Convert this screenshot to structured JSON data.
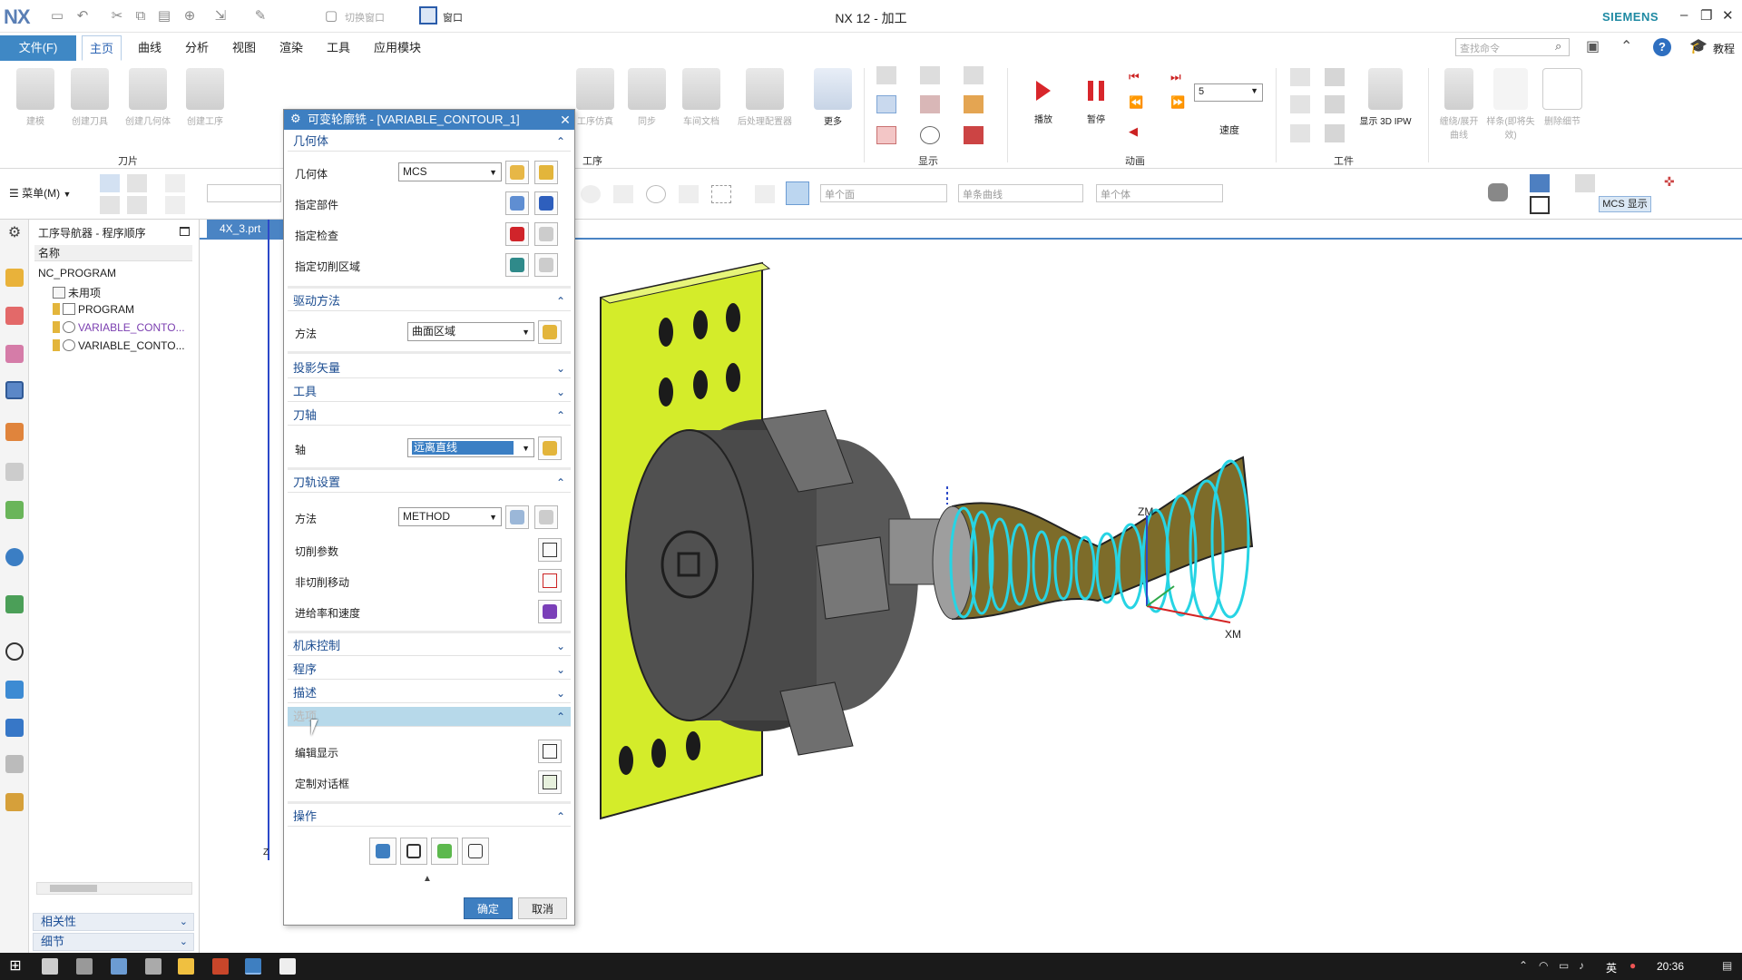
{
  "window": {
    "logo": "NX",
    "title": "NX 12 - 加工",
    "brand": "SIEMENS",
    "quick_access": {
      "switch_window": "切换窗口",
      "window_menu": "窗口"
    }
  },
  "menubar": {
    "file": "文件(F)",
    "tabs": [
      "主页",
      "曲线",
      "分析",
      "视图",
      "渲染",
      "工具",
      "应用模块"
    ],
    "active_tab": "主页",
    "search_placeholder": "查找命令",
    "tutorial": "教程"
  },
  "ribbon": {
    "insert_buttons": [
      "建模",
      "创建刀具",
      "创建几何体",
      "创建工序"
    ],
    "operation_buttons": [
      "工序仿真",
      "同步",
      "车间文档",
      "后处理配置器"
    ],
    "more": "更多",
    "play": "播放",
    "pause": "暂停",
    "speed_label": "速度",
    "speed_value": "5",
    "show_3d_ipw": "显示 3D IPW",
    "disabled_buttons": [
      "缠绕/展开曲线",
      "样条(即将失效)",
      "删除细节"
    ],
    "groups": {
      "tool": "刀片",
      "operation": "工序",
      "display": "显示",
      "animation": "动画",
      "workpiece": "工件"
    }
  },
  "toolbar2": {
    "menu": "菜单(M)",
    "filter_body": "单个面",
    "filter_curve": "单条曲线",
    "filter_single": "单个体",
    "mcs_display": "MCS 显示"
  },
  "navigator": {
    "title": "工序导航器 - 程序顺序",
    "column_name": "名称",
    "rows": [
      {
        "label": "NC_PROGRAM",
        "level": 0
      },
      {
        "label": "未用项",
        "level": 1
      },
      {
        "label": "PROGRAM",
        "level": 1
      },
      {
        "label": "VARIABLE_CONTO...",
        "level": 1,
        "selected": true
      },
      {
        "label": "VARIABLE_CONTO...",
        "level": 1
      }
    ],
    "sections": [
      "相关性",
      "细节"
    ]
  },
  "graphics": {
    "tab": "4X_3.prt",
    "axis_labels": {
      "zm": "ZM",
      "xm": "XM",
      "z": "Z"
    }
  },
  "dialog": {
    "title": "可变轮廓铣 - [VARIABLE_CONTOUR_1]",
    "geometry": {
      "header": "几何体",
      "geometry_label": "几何体",
      "geometry_value": "MCS",
      "specify_part": "指定部件",
      "specify_check": "指定检查",
      "specify_cut_area": "指定切削区域"
    },
    "drive": {
      "header": "驱动方法",
      "method_label": "方法",
      "method_value": "曲面区域"
    },
    "projection_vector": "投影矢量",
    "tool": "工具",
    "tool_axis": {
      "header": "刀轴",
      "axis_label": "轴",
      "axis_value": "远离直线"
    },
    "path_settings": {
      "header": "刀轨设置",
      "method_label": "方法",
      "method_value": "METHOD",
      "cut_params": "切削参数",
      "non_cut_moves": "非切削移动",
      "feeds_speeds": "进给率和速度"
    },
    "machine_control": "机床控制",
    "program": "程序",
    "description": "描述",
    "options": {
      "header": "选项",
      "edit_display": "编辑显示",
      "customize_dialog": "定制对话框"
    },
    "actions": {
      "header": "操作"
    },
    "ok": "确定",
    "cancel": "取消"
  },
  "taskbar": {
    "ime": "英",
    "clock": "20:36"
  },
  "colors": {
    "accent": "#3e7fc1",
    "fixture_yellow": "#d4ec2a",
    "toolpath_cyan": "#27d4e4"
  }
}
